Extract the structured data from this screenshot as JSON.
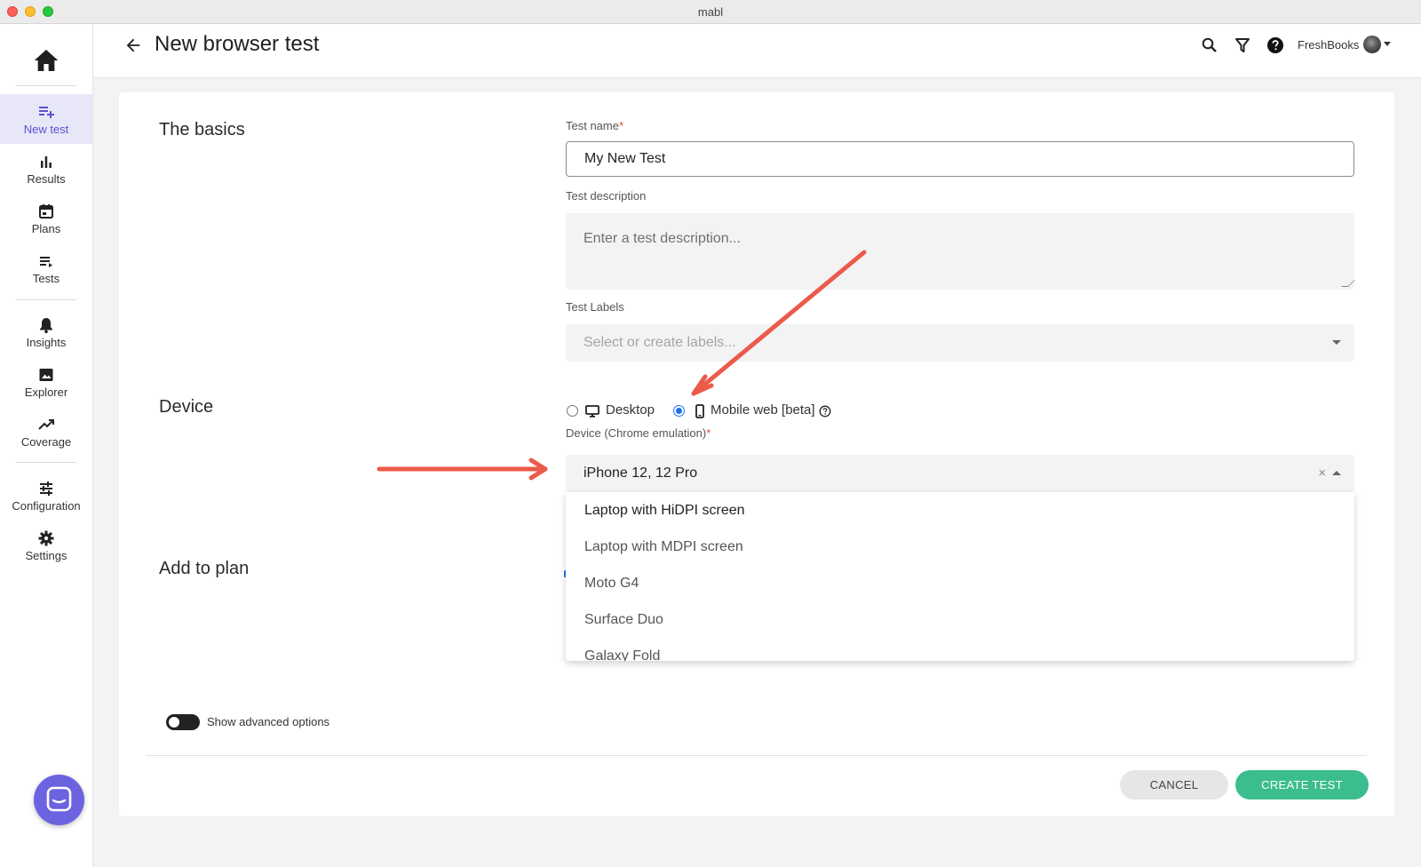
{
  "window": {
    "title": "mabl"
  },
  "sidebar": {
    "items": [
      {
        "id": "new-test",
        "label": "New test",
        "active": true
      },
      {
        "id": "results",
        "label": "Results"
      },
      {
        "id": "plans",
        "label": "Plans"
      },
      {
        "id": "tests",
        "label": "Tests"
      },
      {
        "id": "insights",
        "label": "Insights"
      },
      {
        "id": "explorer",
        "label": "Explorer"
      },
      {
        "id": "coverage",
        "label": "Coverage"
      },
      {
        "id": "configuration",
        "label": "Configuration"
      },
      {
        "id": "settings",
        "label": "Settings"
      }
    ]
  },
  "header": {
    "title": "New browser test",
    "org_name": "FreshBooks"
  },
  "basics": {
    "section_title": "The basics",
    "test_name_label": "Test name",
    "required_mark": "*",
    "test_name_value": "My New Test",
    "description_label": "Test description",
    "description_placeholder": "Enter a test description...",
    "labels_label": "Test Labels",
    "labels_placeholder": "Select or create labels..."
  },
  "device": {
    "section_title": "Device",
    "desktop_label": "Desktop",
    "mobile_label": "Mobile web [beta]",
    "selected": "mobile",
    "emulation_label": "Device (Chrome emulation)",
    "selected_device": "iPhone 12, 12 Pro",
    "clear_symbol": "×",
    "options": [
      "Laptop with HiDPI screen",
      "Laptop with MDPI screen",
      "Moto G4",
      "Surface Duo",
      "Galaxy Fold"
    ]
  },
  "plan": {
    "section_title": "Add to plan"
  },
  "advanced": {
    "toggle_label": "Show advanced options",
    "enabled": false
  },
  "actions": {
    "cancel": "CANCEL",
    "create": "CREATE TEST"
  },
  "colors": {
    "accent": "#5a51d3",
    "primary_button": "#3cbd8e",
    "annotation_arrow": "#ec5a4a",
    "radio_selected": "#1a73e8"
  }
}
